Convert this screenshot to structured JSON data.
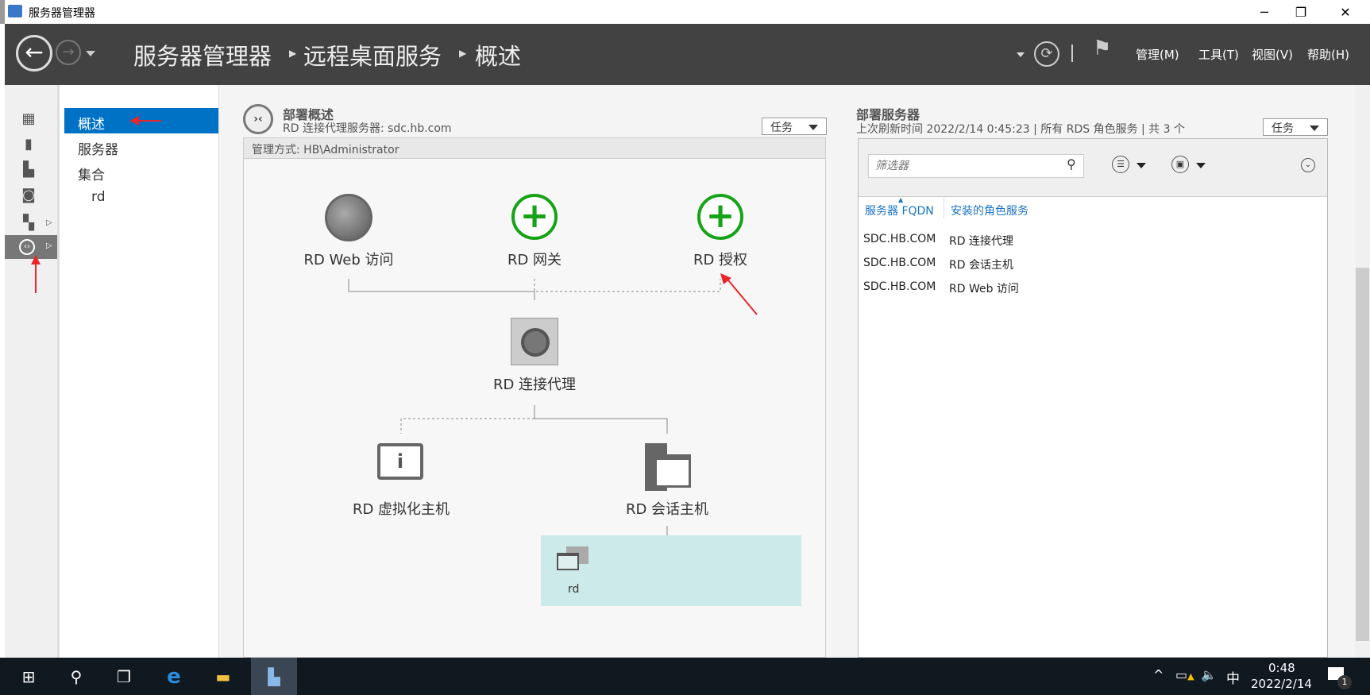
{
  "window": {
    "title": "服务器管理器"
  },
  "header": {
    "breadcrumb": [
      "服务器管理器",
      "远程桌面服务",
      "概述"
    ],
    "menus": [
      "管理(M)",
      "工具(T)",
      "视图(V)",
      "帮助(H)"
    ]
  },
  "nav": {
    "items": [
      "概述",
      "服务器",
      "集合",
      "rd"
    ]
  },
  "overview": {
    "title": "部署概述",
    "subtitle": "RD 连接代理服务器: sdc.hb.com",
    "tasks": "任务",
    "managed_by": "管理方式: HB\\Administrator",
    "nodes": {
      "web": "RD Web 访问",
      "gateway": "RD 网关",
      "licensing": "RD 授权",
      "broker": "RD 连接代理",
      "virtualization": "RD 虚拟化主机",
      "session": "RD 会话主机"
    },
    "collection": "rd"
  },
  "servers": {
    "title": "部署服务器",
    "subtitle": "上次刷新时间 2022/2/14 0:45:23 | 所有 RDS 角色服务  | 共 3 个",
    "tasks": "任务",
    "filter_placeholder": "筛选器",
    "columns": [
      "服务器 FQDN",
      "安装的角色服务"
    ],
    "rows": [
      [
        "SDC.HB.COM",
        "RD 连接代理"
      ],
      [
        "SDC.HB.COM",
        "RD 会话主机"
      ],
      [
        "SDC.HB.COM",
        "RD Web 访问"
      ]
    ]
  },
  "taskbar": {
    "time": "0:48",
    "date": "2022/2/14",
    "ime": "中",
    "notifications": "1"
  },
  "colors": {
    "accent": "#0072c6",
    "header": "#424242",
    "plus": "#17a317",
    "collection": "#cdeaea",
    "arrow": "#e8262a"
  }
}
